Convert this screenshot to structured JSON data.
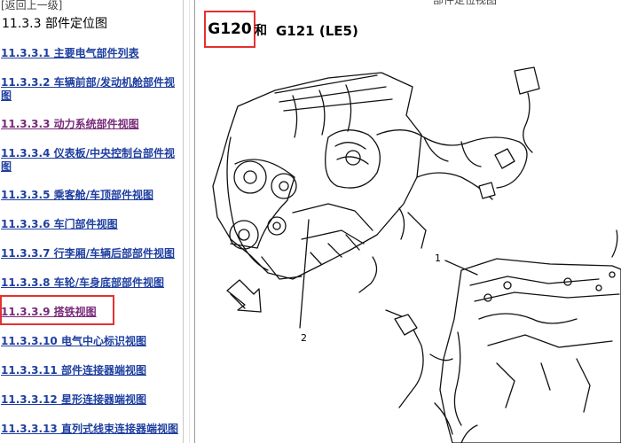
{
  "nav": {
    "back_label": "[返回上一级]"
  },
  "toc": {
    "title": "11.3.3 部件定位图",
    "items": [
      {
        "label": "11.3.3.1  主要电气部件列表",
        "visited": false
      },
      {
        "label": "11.3.3.2  车辆前部/发动机舱部件视图",
        "visited": false
      },
      {
        "label": "11.3.3.3  动力系统部件视图",
        "visited": true
      },
      {
        "label": "11.3.3.4  仪表板/中央控制台部件视图",
        "visited": false
      },
      {
        "label": "11.3.3.5  乘客舱/车顶部件视图",
        "visited": false
      },
      {
        "label": "11.3.3.6  车门部件视图",
        "visited": false
      },
      {
        "label": "11.3.3.7  行李厢/车辆后部部件视图",
        "visited": false
      },
      {
        "label": "11.3.3.8  车轮/车身底部部件视图",
        "visited": false
      },
      {
        "label": "11.3.3.9  搭铁视图",
        "visited": true,
        "highlighted": true
      },
      {
        "label": "11.3.3.10  电气中心标识视图",
        "visited": false
      },
      {
        "label": "11.3.3.11  部件连接器端视图",
        "visited": false
      },
      {
        "label": "11.3.3.12  星形连接器端视图",
        "visited": false
      },
      {
        "label": "11.3.3.13  直列式线束连接器端视图",
        "visited": false
      }
    ]
  },
  "content": {
    "ground_a": "G120",
    "conjunction": "和",
    "ground_b": "G121 (LE5)",
    "top_partial_text": "部件定位视图",
    "callout_1": "1",
    "callout_2": "2"
  },
  "colors": {
    "highlight": "#e53030",
    "link": "#1f3fa0",
    "visited_link": "#7a2a7a"
  }
}
